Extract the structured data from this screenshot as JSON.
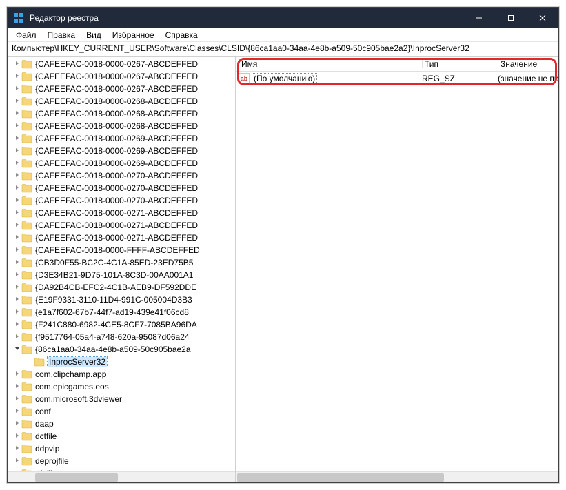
{
  "window": {
    "title": "Редактор реестра"
  },
  "menubar": {
    "file": "Файл",
    "edit": "Правка",
    "view": "Вид",
    "favorites": "Избранное",
    "help": "Справка"
  },
  "address": "Компьютер\\HKEY_CURRENT_USER\\Software\\Classes\\CLSID\\{86ca1aa0-34aa-4e8b-a509-50c905bae2a2}\\InprocServer32",
  "tree": [
    {
      "label": "{CAFEEFAC-0018-0000-0267-ABCDEFFED",
      "indent": 0,
      "exp": true
    },
    {
      "label": "{CAFEEFAC-0018-0000-0267-ABCDEFFED",
      "indent": 0,
      "exp": true
    },
    {
      "label": "{CAFEEFAC-0018-0000-0267-ABCDEFFED",
      "indent": 0,
      "exp": true
    },
    {
      "label": "{CAFEEFAC-0018-0000-0268-ABCDEFFED",
      "indent": 0,
      "exp": true
    },
    {
      "label": "{CAFEEFAC-0018-0000-0268-ABCDEFFED",
      "indent": 0,
      "exp": true
    },
    {
      "label": "{CAFEEFAC-0018-0000-0268-ABCDEFFED",
      "indent": 0,
      "exp": true
    },
    {
      "label": "{CAFEEFAC-0018-0000-0269-ABCDEFFED",
      "indent": 0,
      "exp": true
    },
    {
      "label": "{CAFEEFAC-0018-0000-0269-ABCDEFFED",
      "indent": 0,
      "exp": true
    },
    {
      "label": "{CAFEEFAC-0018-0000-0269-ABCDEFFED",
      "indent": 0,
      "exp": true
    },
    {
      "label": "{CAFEEFAC-0018-0000-0270-ABCDEFFED",
      "indent": 0,
      "exp": true
    },
    {
      "label": "{CAFEEFAC-0018-0000-0270-ABCDEFFED",
      "indent": 0,
      "exp": true
    },
    {
      "label": "{CAFEEFAC-0018-0000-0270-ABCDEFFED",
      "indent": 0,
      "exp": true
    },
    {
      "label": "{CAFEEFAC-0018-0000-0271-ABCDEFFED",
      "indent": 0,
      "exp": true
    },
    {
      "label": "{CAFEEFAC-0018-0000-0271-ABCDEFFED",
      "indent": 0,
      "exp": true
    },
    {
      "label": "{CAFEEFAC-0018-0000-0271-ABCDEFFED",
      "indent": 0,
      "exp": true
    },
    {
      "label": "{CAFEEFAC-0018-0000-FFFF-ABCDEFFED",
      "indent": 0,
      "exp": true
    },
    {
      "label": "{CB3D0F55-BC2C-4C1A-85ED-23ED75B5",
      "indent": 0,
      "exp": true
    },
    {
      "label": "{D3E34B21-9D75-101A-8C3D-00AA001A1",
      "indent": 0,
      "exp": true
    },
    {
      "label": "{DA92B4CB-EFC2-4C1B-AEB9-DF592DDE",
      "indent": 0,
      "exp": true
    },
    {
      "label": "{E19F9331-3110-11D4-991C-005004D3B3",
      "indent": 0,
      "exp": true
    },
    {
      "label": "{e1a7f602-67b7-44f7-ad19-439e41f06cd8",
      "indent": 0,
      "exp": true
    },
    {
      "label": "{F241C880-6982-4CE5-8CF7-7085BA96DA",
      "indent": 0,
      "exp": true
    },
    {
      "label": "{f9517764-05a4-a748-620a-95087d06a24",
      "indent": 0,
      "exp": true
    },
    {
      "label": "{86ca1aa0-34aa-4e8b-a509-50c905bae2a",
      "indent": 0,
      "exp": true,
      "open": true
    },
    {
      "label": "InprocServer32",
      "indent": 1,
      "exp": false,
      "selected": true
    },
    {
      "label": "com.clipchamp.app",
      "indent": 0,
      "exp": true
    },
    {
      "label": "com.epicgames.eos",
      "indent": 0,
      "exp": true
    },
    {
      "label": "com.microsoft.3dviewer",
      "indent": 0,
      "exp": true
    },
    {
      "label": "conf",
      "indent": 0,
      "exp": true
    },
    {
      "label": "daap",
      "indent": 0,
      "exp": true
    },
    {
      "label": "dctfile",
      "indent": 0,
      "exp": true
    },
    {
      "label": "ddpvip",
      "indent": 0,
      "exp": true
    },
    {
      "label": "deprojfile",
      "indent": 0,
      "exp": true
    },
    {
      "label": "dfxfile",
      "indent": 0,
      "exp": true
    }
  ],
  "columns": {
    "name": "Имя",
    "type": "Тип",
    "data": "Значение"
  },
  "values": [
    {
      "name": "(По умолчанию)",
      "type": "REG_SZ",
      "data": "(значение не присво"
    }
  ],
  "icons": {
    "string_ab": "ab"
  }
}
